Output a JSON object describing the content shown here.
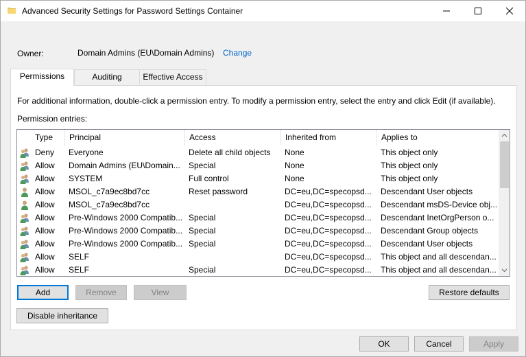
{
  "window": {
    "title": "Advanced Security Settings for Password Settings Container",
    "icon": "folder-icon"
  },
  "owner": {
    "label": "Owner:",
    "value": "Domain Admins (EU\\Domain Admins)",
    "change_link": "Change"
  },
  "tabs": [
    {
      "label": "Permissions",
      "active": true
    },
    {
      "label": "Auditing",
      "active": false
    },
    {
      "label": "Effective Access",
      "active": false
    }
  ],
  "permissions": {
    "info_text": "For additional information, double-click a permission entry. To modify a permission entry, select the entry and click Edit (if available).",
    "entries_label": "Permission entries:",
    "columns": [
      "Type",
      "Principal",
      "Access",
      "Inherited from",
      "Applies to"
    ],
    "rows": [
      {
        "icon": "group-icon",
        "type": "Deny",
        "principal": "Everyone",
        "access": "Delete all child objects",
        "inherited": "None",
        "applies": "This object only"
      },
      {
        "icon": "group-icon",
        "type": "Allow",
        "principal": "Domain Admins (EU\\Domain...",
        "access": "Special",
        "inherited": "None",
        "applies": "This object only"
      },
      {
        "icon": "group-icon",
        "type": "Allow",
        "principal": "SYSTEM",
        "access": "Full control",
        "inherited": "None",
        "applies": "This object only"
      },
      {
        "icon": "user-icon",
        "type": "Allow",
        "principal": "MSOL_c7a9ec8bd7cc",
        "access": "Reset password",
        "inherited": "DC=eu,DC=specopsd...",
        "applies": "Descendant User objects"
      },
      {
        "icon": "user-icon",
        "type": "Allow",
        "principal": "MSOL_c7a9ec8bd7cc",
        "access": "",
        "inherited": "DC=eu,DC=specopsd...",
        "applies": "Descendant msDS-Device obj..."
      },
      {
        "icon": "group-icon",
        "type": "Allow",
        "principal": "Pre-Windows 2000 Compatib...",
        "access": "Special",
        "inherited": "DC=eu,DC=specopsd...",
        "applies": "Descendant InetOrgPerson o..."
      },
      {
        "icon": "group-icon",
        "type": "Allow",
        "principal": "Pre-Windows 2000 Compatib...",
        "access": "Special",
        "inherited": "DC=eu,DC=specopsd...",
        "applies": "Descendant Group objects"
      },
      {
        "icon": "group-icon",
        "type": "Allow",
        "principal": "Pre-Windows 2000 Compatib...",
        "access": "Special",
        "inherited": "DC=eu,DC=specopsd...",
        "applies": "Descendant User objects"
      },
      {
        "icon": "group-icon",
        "type": "Allow",
        "principal": "SELF",
        "access": "",
        "inherited": "DC=eu,DC=specopsd...",
        "applies": "This object and all descendan..."
      },
      {
        "icon": "group-icon",
        "type": "Allow",
        "principal": "SELF",
        "access": "Special",
        "inherited": "DC=eu,DC=specopsd...",
        "applies": "This object and all descendan..."
      }
    ]
  },
  "buttons": {
    "add": "Add",
    "remove": "Remove",
    "view": "View",
    "restore_defaults": "Restore defaults",
    "disable_inheritance": "Disable inheritance",
    "ok": "OK",
    "cancel": "Cancel",
    "apply": "Apply"
  },
  "colors": {
    "link": "#0066cc",
    "focus_border": "#0078d7",
    "window_bg": "#f0f0f0",
    "panel_bg": "#ffffff"
  }
}
